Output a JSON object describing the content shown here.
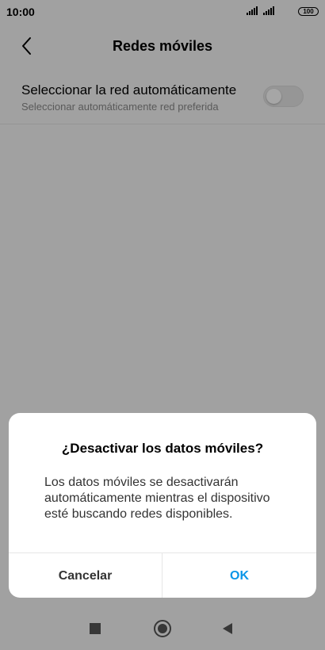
{
  "status_bar": {
    "time": "10:00",
    "battery": "100",
    "signal_icons": [
      "signal-icon",
      "signal-icon"
    ]
  },
  "header": {
    "title": "Redes móviles",
    "back_icon": "chevron-left-icon"
  },
  "setting": {
    "title": "Seleccionar la red automáticamente",
    "subtitle": "Seleccionar automáticamente red preferida",
    "toggle_on": false
  },
  "dialog": {
    "title": "¿Desactivar los datos móviles?",
    "message_lines": [
      "Los datos móviles se desactivarán",
      "automáticamente mientras el dispositivo",
      "esté buscando redes disponibles."
    ],
    "cancel_label": "Cancelar",
    "ok_label": "OK"
  },
  "nav_bar": {
    "icons": [
      "recents-square-icon",
      "home-circle-icon",
      "back-triangle-icon"
    ]
  },
  "colors": {
    "accent": "#0a96e8",
    "scrim": "rgba(0,0,0,0.35)"
  }
}
